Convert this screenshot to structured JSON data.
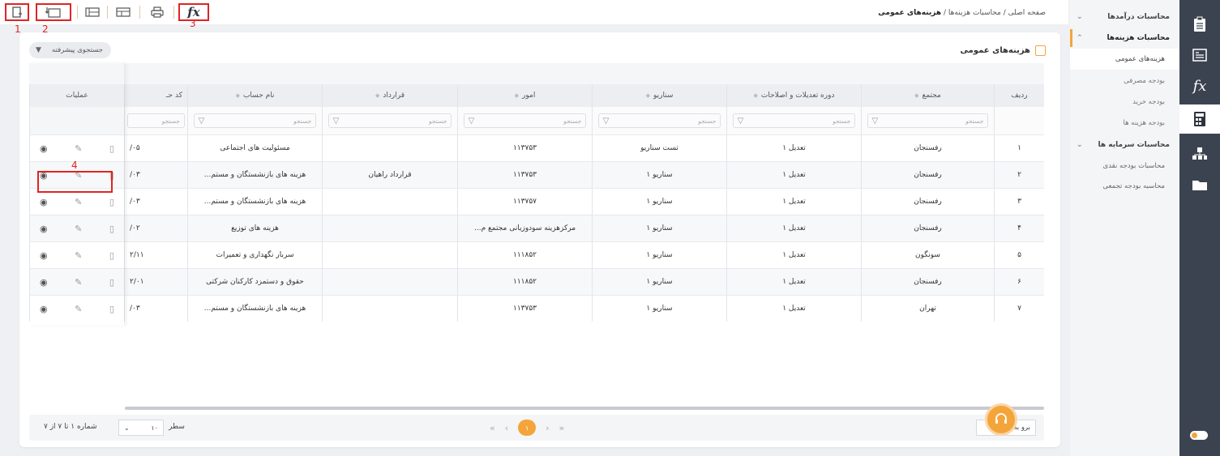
{
  "toolbar": {
    "annotations": [
      "1",
      "2",
      "3"
    ],
    "fx_label": "fx"
  },
  "breadcrumb": {
    "home": "صفحه اصلی",
    "parent": "محاسبات هزینه‌ها",
    "current": "هزینه‌های عمومی",
    "sep": "/"
  },
  "rail": {
    "fx_label": "fx",
    "icons": [
      "clipboard-icon",
      "list-icon",
      "fx-icon",
      "calculator-icon",
      "org-chart-icon",
      "folder-icon"
    ]
  },
  "menu": {
    "items": [
      {
        "label": "محاسبات درآمدها",
        "chev": "⌄"
      },
      {
        "label": "محاسبات هزینه‌ها",
        "chev": "⌃"
      },
      {
        "label": "هزینه‌های عمومی"
      },
      {
        "label": "بودجه مصرفی"
      },
      {
        "label": "بودجه خرید"
      },
      {
        "label": "بودجه هزینه ها"
      },
      {
        "label": "محاسبات سرمایه ها",
        "chev": "⌄"
      },
      {
        "label": "محاسبات بودجه نقدی"
      },
      {
        "label": "محاسبه بودجه تجمعی"
      }
    ]
  },
  "card": {
    "title": "هزینه‌های عمومی",
    "advanced_search": "جستجوی پیشرفته"
  },
  "table": {
    "columns": [
      "ردیف",
      "مجتمع",
      "دوره تعدیلات و اصلاحات",
      "سناریو",
      "امور",
      "قرارداد",
      "نام حساب",
      "کد حـ",
      "عملیات"
    ],
    "filter_placeholder": "جستجو",
    "ops_annotation": "4",
    "rows": [
      {
        "idx": "۱",
        "complex": "رفسنجان",
        "period": "تعدیل ۱",
        "scenario": "تست سناریو",
        "affairs": "۱۱۳۷۵۳",
        "contract": "",
        "account": "مسئولیت های اجتماعی",
        "code": "/۰۵"
      },
      {
        "idx": "۲",
        "complex": "رفسنجان",
        "period": "تعدیل ۱",
        "scenario": "سناریو ۱",
        "affairs": "۱۱۳۷۵۳",
        "contract": "قرارداد راهیان",
        "account": "هزینه های بازنشستگان و مستم...",
        "code": "/۰۳"
      },
      {
        "idx": "۳",
        "complex": "رفسنجان",
        "period": "تعدیل ۱",
        "scenario": "سناریو ۱",
        "affairs": "۱۱۳۷۵۷",
        "contract": "",
        "account": "هزینه های بازنشستگان و مستم...",
        "code": "/۰۳"
      },
      {
        "idx": "۴",
        "complex": "رفسنجان",
        "period": "تعدیل ۱",
        "scenario": "سناریو ۱",
        "affairs": "مرکزهزینه سودوزیانی مجتمع م...",
        "contract": "",
        "account": "هزینه های توزیع",
        "code": "/۰۲"
      },
      {
        "idx": "۵",
        "complex": "سونگون",
        "period": "تعدیل ۱",
        "scenario": "سناریو ۱",
        "affairs": "۱۱۱۸۵۲",
        "contract": "",
        "account": "سربار نگهداری و تعمیرات",
        "code": "۲/۱۱"
      },
      {
        "idx": "۶",
        "complex": "رفسنجان",
        "period": "تعدیل ۱",
        "scenario": "سناریو ۱",
        "affairs": "۱۱۱۸۵۲",
        "contract": "",
        "account": "حقوق و دستمزد کارکنان شرکتی",
        "code": "۲/۰۱"
      },
      {
        "idx": "۷",
        "complex": "تهران",
        "period": "تعدیل ۱",
        "scenario": "سناریو ۱",
        "affairs": "۱۱۳۷۵۳",
        "contract": "",
        "account": "هزینه های بازنشستگان و مستم...",
        "code": "/۰۳"
      }
    ]
  },
  "footer": {
    "page_info": "شماره ۱ تا ۷ از ۷",
    "page_size": "۱۰",
    "rows_label": "سطر",
    "current_page": "۱",
    "goto_label": "برو به",
    "first": "«",
    "prev": "‹",
    "next": "›",
    "last": "»"
  },
  "colors": {
    "accent": "#f4a53a",
    "annotation": "#e02424",
    "rail": "#3c4350"
  }
}
